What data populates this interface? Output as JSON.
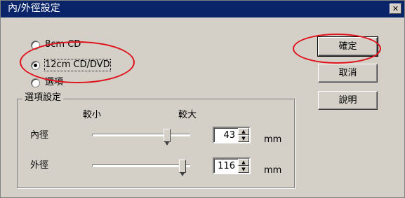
{
  "window": {
    "title": "內/外徑設定",
    "close_glyph": "✕"
  },
  "disc_options": [
    {
      "label": "8cm CD",
      "checked": false
    },
    {
      "label": "12cm CD/DVD",
      "checked": true
    },
    {
      "label": "選項",
      "checked": false
    }
  ],
  "buttons": {
    "ok": "確定",
    "cancel": "取消",
    "help": "說明"
  },
  "group": {
    "title": "選項設定",
    "min_label": "較小",
    "max_label": "較大",
    "inner": {
      "label": "內徑",
      "value": "43",
      "unit": "mm",
      "slider_fraction": 0.77
    },
    "outer": {
      "label": "外徑",
      "value": "116",
      "unit": "mm",
      "slider_fraction": 0.93
    }
  },
  "icons": {
    "spin_up": "▲",
    "spin_down": "▼"
  },
  "colors": {
    "titlebar": "#0a246a",
    "face": "#d4d0c8",
    "annotation": "#e0111b"
  }
}
